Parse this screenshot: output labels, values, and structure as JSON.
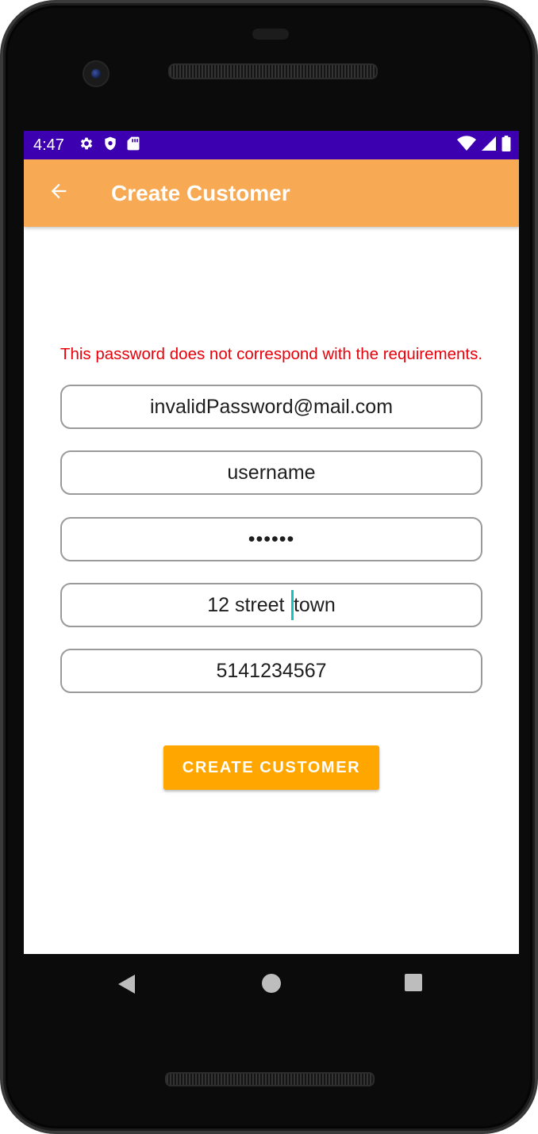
{
  "status_bar": {
    "time": "4:47",
    "left_icons": [
      "gear-icon",
      "shield-icon",
      "sd-card-icon"
    ],
    "right_icons": [
      "wifi-icon",
      "signal-icon",
      "battery-icon"
    ],
    "background_color": "#3d00b0"
  },
  "app_bar": {
    "title": "Create Customer",
    "back_icon": "arrow-back-icon",
    "background_color": "#f7a953"
  },
  "form": {
    "error_message": "This password does not correspond with the requirements.",
    "email_value": "invalidPassword@mail.com",
    "username_value": "username",
    "password_value": "••••••",
    "address_before_cursor": "12 street ",
    "address_after_cursor": "town",
    "phone_value": "5141234567",
    "submit_label": "CREATE CUSTOMER",
    "accent_color": "#ffa600",
    "error_color": "#e8000b"
  },
  "navigation": {
    "icons": [
      "nav-back-icon",
      "nav-home-icon",
      "nav-recents-icon"
    ]
  }
}
